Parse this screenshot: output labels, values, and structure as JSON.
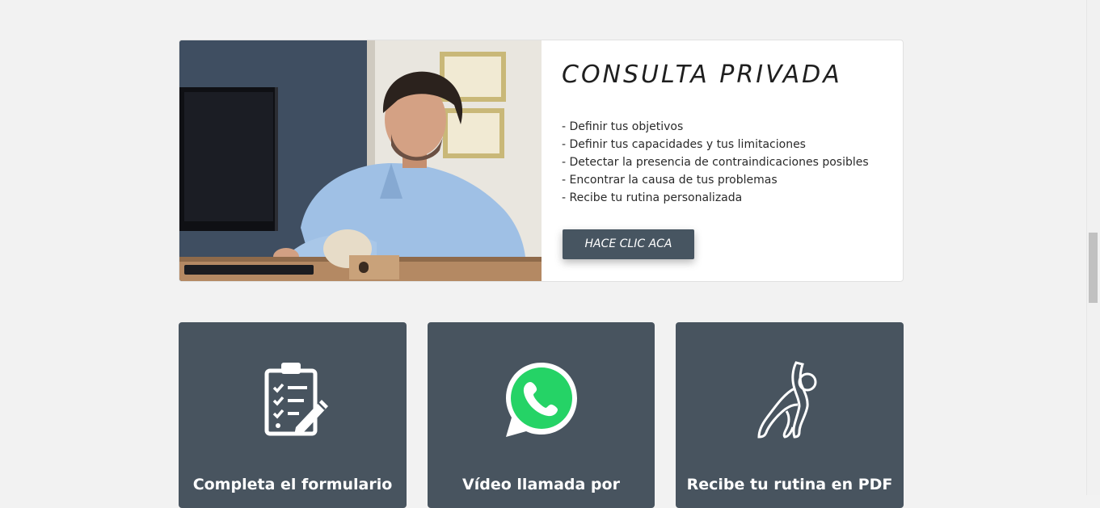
{
  "hero": {
    "photo": "man-at-desk-photo",
    "title": "CONSULTA PRIVADA",
    "items": [
      "- Definir tus objetivos",
      "- Definir tus capacidades y tus limitaciones",
      "- Detectar la presencia de contraindicaciones posibles",
      "- Encontrar la causa de tus problemas",
      "- Recibe tu rutina personalizada"
    ],
    "button_label": "HACE CLIC ACA"
  },
  "features": [
    {
      "icon": "clipboard-checklist-icon",
      "label": "Completa el formulario"
    },
    {
      "icon": "whatsapp-icon",
      "label": "Vídeo llamada por"
    },
    {
      "icon": "stretching-person-icon",
      "label": "Recibe tu rutina en PDF"
    }
  ],
  "colors": {
    "page_background": "#f2f2f2",
    "card_background": "#48545f",
    "button_background": "#475561",
    "whatsapp_green": "#25d366"
  }
}
